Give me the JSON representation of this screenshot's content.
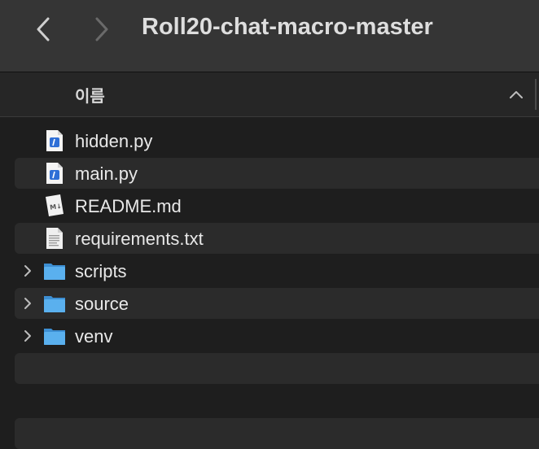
{
  "window": {
    "title": "Roll20-chat-macro-master"
  },
  "toolbar": {
    "back_icon": "chevron-left-icon",
    "forward_icon": "chevron-right-icon"
  },
  "columns": {
    "name_label": "이름",
    "sort_direction": "ascending"
  },
  "files": [
    {
      "name": "hidden.py",
      "kind": "python",
      "icon": "python-file-icon",
      "expandable": false
    },
    {
      "name": "main.py",
      "kind": "python",
      "icon": "python-file-icon",
      "expandable": false
    },
    {
      "name": "README.md",
      "kind": "markdown",
      "icon": "markdown-file-icon",
      "expandable": false
    },
    {
      "name": "requirements.txt",
      "kind": "text",
      "icon": "text-file-icon",
      "expandable": false
    },
    {
      "name": "scripts",
      "kind": "folder",
      "icon": "folder-icon",
      "expandable": true
    },
    {
      "name": "source",
      "kind": "folder",
      "icon": "folder-icon",
      "expandable": true
    },
    {
      "name": "venv",
      "kind": "folder",
      "icon": "folder-icon",
      "expandable": true
    }
  ],
  "colors": {
    "toolbar": "#353535",
    "background": "#1e1e1e",
    "row_alt": "#2b2b2b",
    "folder_blue": "#4aa3e6",
    "python_blue": "#2f6fd6"
  }
}
